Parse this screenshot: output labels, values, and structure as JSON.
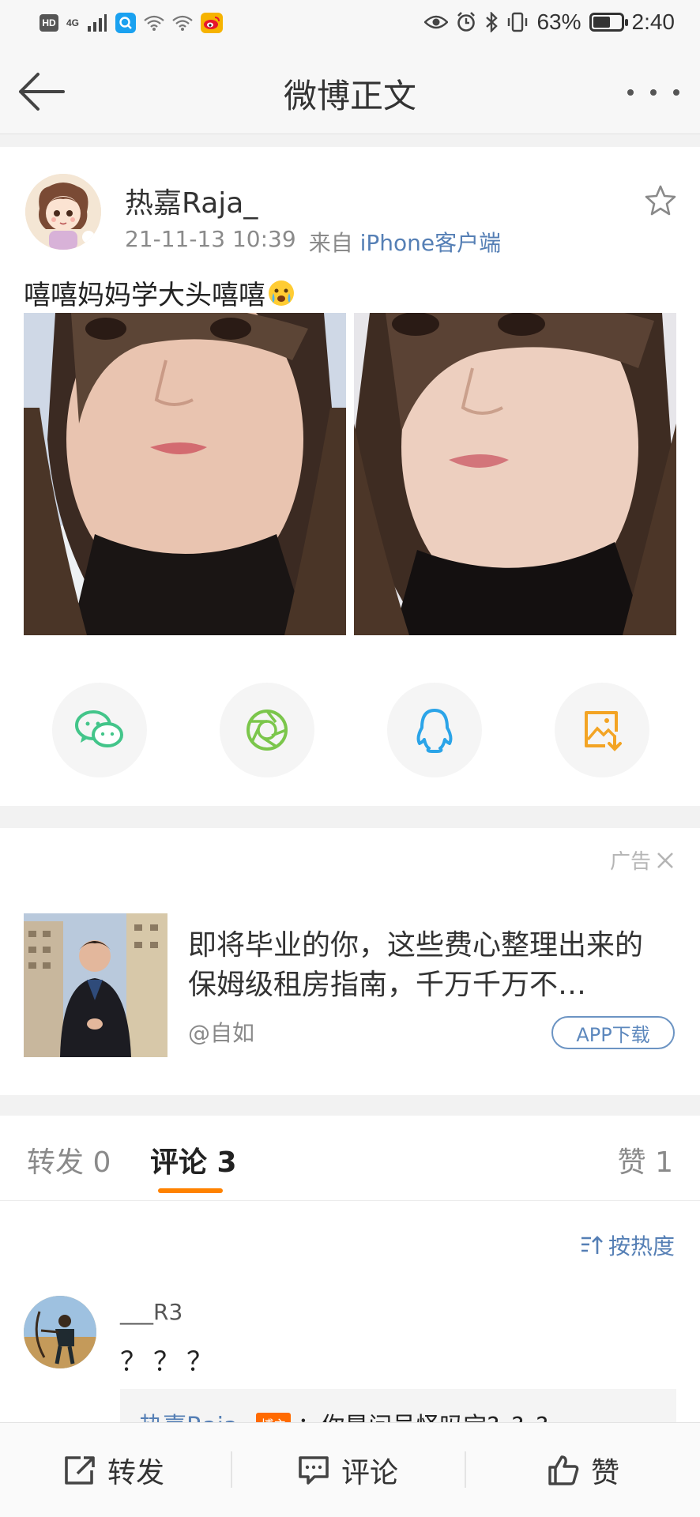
{
  "status_bar": {
    "hd": "HD",
    "network": "4G",
    "battery_percent": "63%",
    "battery_level": 0.63,
    "time": "2:40",
    "icons": [
      "hd-icon",
      "signal-icon",
      "q-app-icon",
      "wifi-icon",
      "wifi-icon",
      "weibo-app-icon",
      "eye-icon",
      "alarm-icon",
      "bluetooth-icon",
      "vibrate-icon",
      "battery-icon"
    ]
  },
  "nav": {
    "title": "微博正文",
    "back_icon": "arrow-left-icon",
    "more_icon": "more-dots-icon"
  },
  "post": {
    "user_name": "热嘉Raja_",
    "time": "21-11-13 10:39",
    "source_prefix": "来自",
    "source": "iPhone客户端",
    "text": "嘻嘻妈妈学大头嘻嘻",
    "emoji": "crying-face-emoji",
    "photo_count": 2,
    "share_targets": [
      {
        "icon": "wechat-icon",
        "color": "#43c58a"
      },
      {
        "icon": "moments-icon",
        "color": "#7bc64b"
      },
      {
        "icon": "qq-icon",
        "color": "#2ba4e8"
      },
      {
        "icon": "save-image-icon",
        "color": "#f3a424"
      }
    ]
  },
  "ad": {
    "label": "广告",
    "title": "即将毕业的你，这些费心整理出来的保姆级租房指南，千万千万不…",
    "source": "@自如",
    "cta": "APP下载"
  },
  "tabs": {
    "repost": "转发 0",
    "comment": "评论 3",
    "like": "赞 1"
  },
  "comments": {
    "sort_label": "按热度",
    "items": [
      {
        "user": "___R3",
        "text": "？？？",
        "reply_user": "热嘉Raja_",
        "reply_badge": "博主",
        "reply_text": "：你是问号怪吗宝?_?_?"
      }
    ]
  },
  "bottom_bar": {
    "repost": "转发",
    "comment": "评论",
    "like": "赞"
  },
  "colors": {
    "accent_orange": "#ff8200",
    "link_blue": "#557fb5"
  }
}
